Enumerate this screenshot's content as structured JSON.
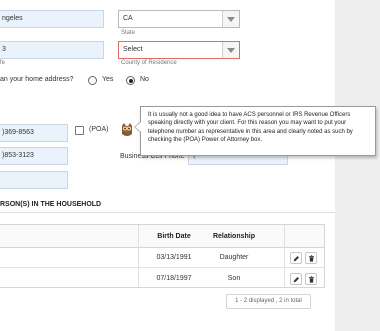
{
  "address": {
    "city_value": "ngeles",
    "state_value": "CA",
    "state_label": "State",
    "zip_value": "3",
    "county_value": "Select",
    "county_label": "County of Residence",
    "left_label_fragment": "fe"
  },
  "question": {
    "text": "an your home address?",
    "options": [
      {
        "label": "Yes",
        "selected": false
      },
      {
        "label": "No",
        "selected": true
      }
    ]
  },
  "phones": {
    "phone1_value": ")369-8563",
    "poa_label": "(POA)",
    "phone2_value": ")853-3123",
    "business_cell_label": "Business Cell Phone",
    "business_cell_value": "("
  },
  "tooltip": {
    "text": "It is usually not a good idea to have ACS personnel or IRS Revenue Officers speaking directly with your client. For this reason you may want to put your telephone number as representative in this area and clearly noted as such by checking the (POA) Power of Attorney box."
  },
  "household": {
    "title": "RSON(S) IN THE HOUSEHOLD",
    "columns": [
      "Birth Date",
      "Relationship"
    ],
    "rows": [
      {
        "birth_date": "03/13/1991",
        "relationship": "Daughter"
      },
      {
        "birth_date": "07/18/1997",
        "relationship": "Son"
      }
    ],
    "pager_text": "1 - 2 displayed , 2 in total"
  },
  "icons": {
    "edit": "pencil-icon",
    "delete": "trash-icon",
    "owl": "owl-icon"
  }
}
